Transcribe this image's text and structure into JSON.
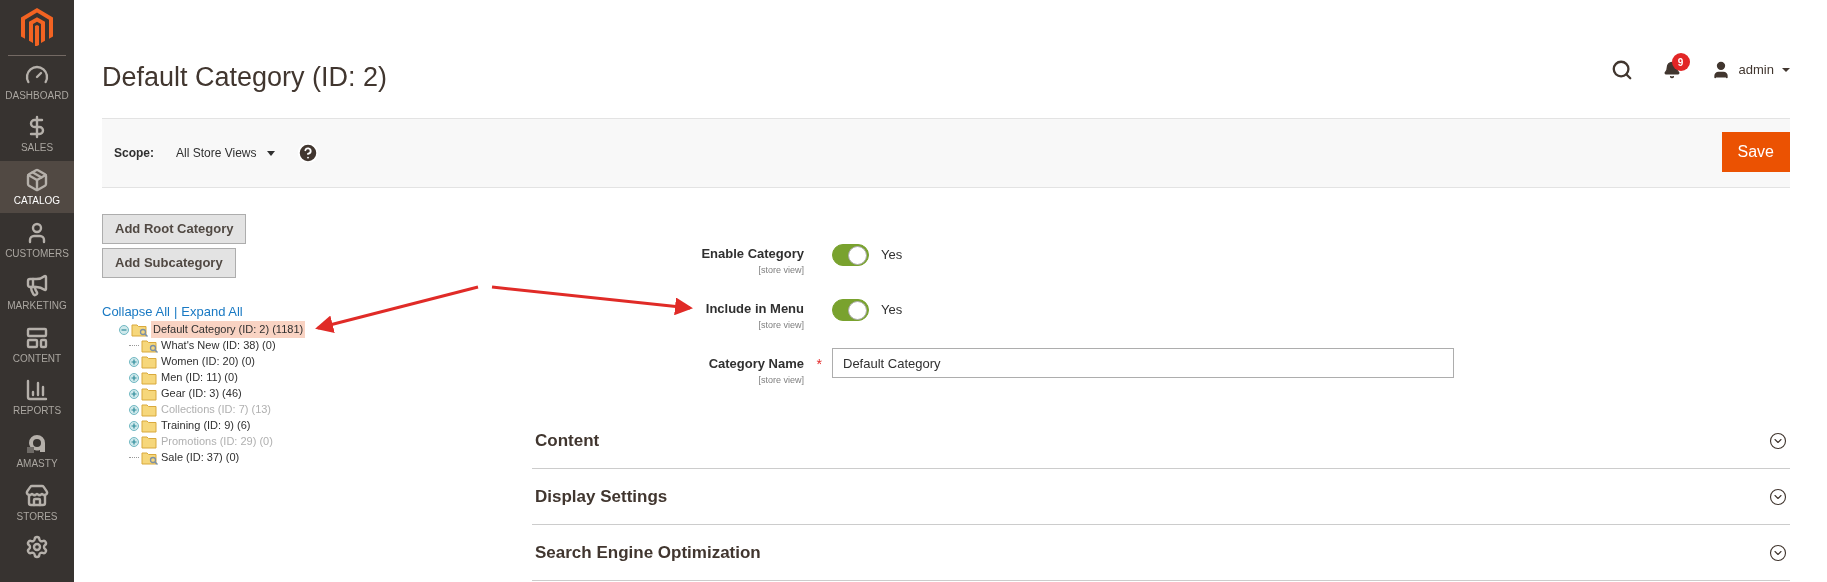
{
  "sidebar": {
    "items": [
      {
        "label": "DASHBOARD",
        "selected": false
      },
      {
        "label": "SALES",
        "selected": false
      },
      {
        "label": "CATALOG",
        "selected": true
      },
      {
        "label": "CUSTOMERS",
        "selected": false
      },
      {
        "label": "MARKETING",
        "selected": false
      },
      {
        "label": "CONTENT",
        "selected": false
      },
      {
        "label": "REPORTS",
        "selected": false
      },
      {
        "label": "AMASTY",
        "selected": false
      },
      {
        "label": "STORES",
        "selected": false
      }
    ]
  },
  "page": {
    "title": "Default Category (ID: 2)"
  },
  "header": {
    "notifications": "9",
    "user": "admin"
  },
  "scope_bar": {
    "label": "Scope:",
    "value": "All Store Views",
    "save": "Save"
  },
  "tree": {
    "buttons": [
      "Add Root Category",
      "Add Subcategory"
    ],
    "collapse": "Collapse All",
    "separator": "|",
    "expand": "Expand All",
    "root": {
      "label": "Default Category (ID: 2) (1181)",
      "selected": true,
      "expanded": true,
      "children": [
        {
          "label": "What's New (ID: 38) (0)",
          "kind": "leaf",
          "disabled": false
        },
        {
          "label": "Women (ID: 20) (0)",
          "kind": "folder",
          "disabled": false
        },
        {
          "label": "Men (ID: 11) (0)",
          "kind": "folder",
          "disabled": false
        },
        {
          "label": "Gear (ID: 3) (46)",
          "kind": "folder",
          "disabled": false
        },
        {
          "label": "Collections (ID: 7) (13)",
          "kind": "folder",
          "disabled": true
        },
        {
          "label": "Training (ID: 9) (6)",
          "kind": "folder",
          "disabled": false
        },
        {
          "label": "Promotions (ID: 29) (0)",
          "kind": "folder",
          "disabled": true
        },
        {
          "label": "Sale (ID: 37) (0)",
          "kind": "leaf",
          "disabled": false
        }
      ]
    }
  },
  "form": {
    "fields": [
      {
        "kind": "toggle",
        "label": "Enable Category",
        "scope": "[store view]",
        "on": true,
        "value": "Yes"
      },
      {
        "kind": "toggle",
        "label": "Include in Menu",
        "scope": "[store view]",
        "on": true,
        "value": "Yes"
      },
      {
        "kind": "text",
        "label": "Category Name",
        "scope": "[store view]",
        "required_mark": "*",
        "value": "Default Category"
      }
    ]
  },
  "sections": [
    {
      "title": "Content",
      "expanded": false
    },
    {
      "title": "Display Settings",
      "expanded": false
    },
    {
      "title": "Search Engine Optimization",
      "expanded": false
    }
  ]
}
